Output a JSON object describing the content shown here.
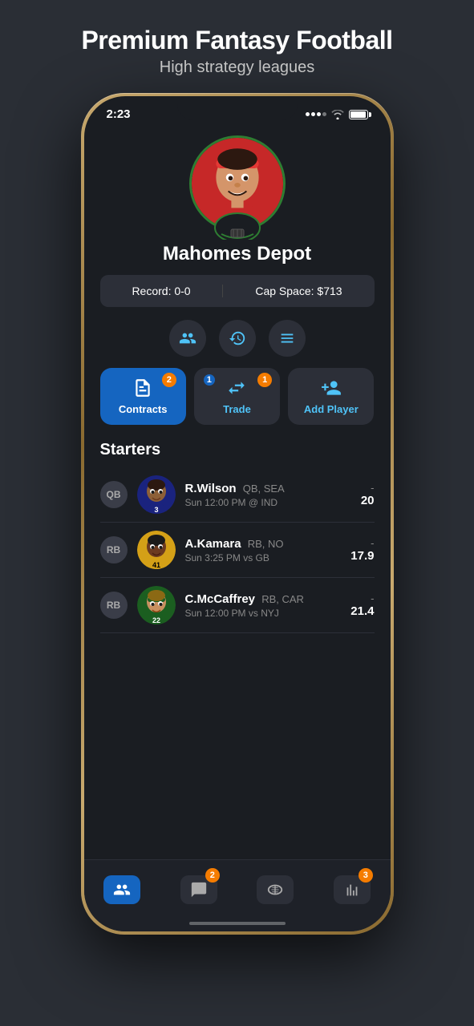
{
  "page": {
    "title": "Premium Fantasy Football",
    "subtitle": "High strategy leagues"
  },
  "status_bar": {
    "time": "2:23"
  },
  "team": {
    "name": "Mahomes Depot",
    "record_label": "Record:",
    "record_value": "0-0",
    "cap_label": "Cap Space:",
    "cap_value": "$713"
  },
  "icon_row": [
    {
      "name": "roster-icon",
      "active": false
    },
    {
      "name": "history-icon",
      "active": false
    },
    {
      "name": "lineup-icon",
      "active": false
    }
  ],
  "action_buttons": [
    {
      "id": "contracts",
      "label": "Contracts",
      "badge": "2",
      "badge_type": "orange",
      "active": true
    },
    {
      "id": "trade",
      "label": "Trade",
      "badge_top": "1",
      "badge_top_type": "blue",
      "badge_bottom": "1",
      "badge_bottom_type": "orange",
      "active": false
    },
    {
      "id": "add-player",
      "label": "Add Player",
      "active": false
    }
  ],
  "starters_title": "Starters",
  "players": [
    {
      "position": "QB",
      "name": "R.Wilson",
      "team_pos": "QB, SEA",
      "game": "Sun 12:00 PM @ IND",
      "score_dash": "-",
      "score": "20"
    },
    {
      "position": "RB",
      "name": "A.Kamara",
      "team_pos": "RB, NO",
      "game": "Sun 3:25 PM vs GB",
      "score_dash": "-",
      "score": "17.9"
    },
    {
      "position": "RB",
      "name": "C.McCaffrey",
      "team_pos": "RB, CAR",
      "game": "Sun 12:00 PM vs NYJ",
      "score_dash": "-",
      "score": "21.4"
    }
  ],
  "tab_bar": [
    {
      "id": "roster",
      "active": true,
      "badge": null
    },
    {
      "id": "chat",
      "active": false,
      "badge": "2"
    },
    {
      "id": "football",
      "active": false,
      "badge": null
    },
    {
      "id": "stats",
      "active": false,
      "badge": "3"
    }
  ]
}
